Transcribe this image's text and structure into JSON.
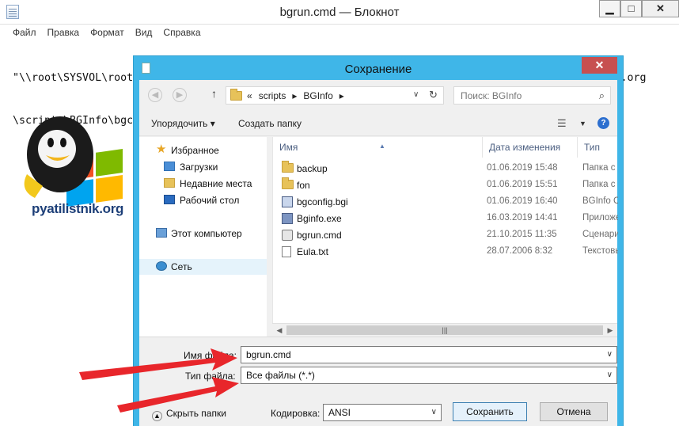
{
  "notepad": {
    "title": "bgrun.cmd — Блокнот",
    "menu": [
      "Файл",
      "Правка",
      "Формат",
      "Вид",
      "Справка"
    ],
    "text_lines": [
      "\"\\\\root\\SYSVOL\\root.pyatilistnik.org\\scripts\\BGInfo\\Bginfo.exe\" \"\\\\root\\SYSVOL\\root.pyatilistnik.org",
      "\\scripts\\BGInfo\\bgc"
    ],
    "window_buttons": {
      "minimize": "▁",
      "maximize": "□",
      "close": "✕"
    }
  },
  "logo": {
    "text": "pyatilistnik.org"
  },
  "dialog": {
    "title": "Сохранение",
    "close_label": "✕",
    "address": {
      "crumbs": [
        "«",
        "scripts",
        "▸",
        "BGInfo",
        "▸"
      ],
      "dropdown_glyph": "∨",
      "refresh_glyph": "↻"
    },
    "search": {
      "placeholder": "Поиск: BGInfo",
      "icon": "search-icon"
    },
    "toolbar": {
      "organize": "Упорядочить ▾",
      "new_folder": "Создать папку",
      "view_glyph": "☰",
      "help_glyph": "?"
    },
    "nav": {
      "favorites": "Избранное",
      "downloads": "Загрузки",
      "recent": "Недавние места",
      "desktop": "Рабочий стол",
      "computer": "Этот компьютер",
      "network": "Сеть"
    },
    "columns": {
      "name": "Имя",
      "date": "Дата изменения",
      "type": "Тип"
    },
    "files": [
      {
        "name": "backup",
        "date": "01.06.2019 15:48",
        "type": "Папка с ф",
        "kind": "folder"
      },
      {
        "name": "fon",
        "date": "01.06.2019 15:51",
        "type": "Папка с ф",
        "kind": "folder"
      },
      {
        "name": "bgconfig.bgi",
        "date": "01.06.2019 16:40",
        "type": "BGInfo Co",
        "kind": "cfg"
      },
      {
        "name": "Bginfo.exe",
        "date": "16.03.2019 14:41",
        "type": "Приложе",
        "kind": "exe"
      },
      {
        "name": "bgrun.cmd",
        "date": "21.10.2015 11:35",
        "type": "Сценарий",
        "kind": "cmd"
      },
      {
        "name": "Eula.txt",
        "date": "28.07.2006 8:32",
        "type": "Текстовы",
        "kind": "txt"
      }
    ],
    "filename_label": "Имя файла:",
    "filename_value": "bgrun.cmd",
    "filetype_label": "Тип файла:",
    "filetype_value": "Все файлы  (*.*)",
    "hide_folders": "Скрыть папки",
    "encoding_label": "Кодировка:",
    "encoding_value": "ANSI",
    "save_button": "Сохранить",
    "cancel_button": "Отмена"
  },
  "colors": {
    "dialog_frame": "#3fb6e8",
    "close_button": "#c75050",
    "annotation_arrow": "#e8262b"
  }
}
